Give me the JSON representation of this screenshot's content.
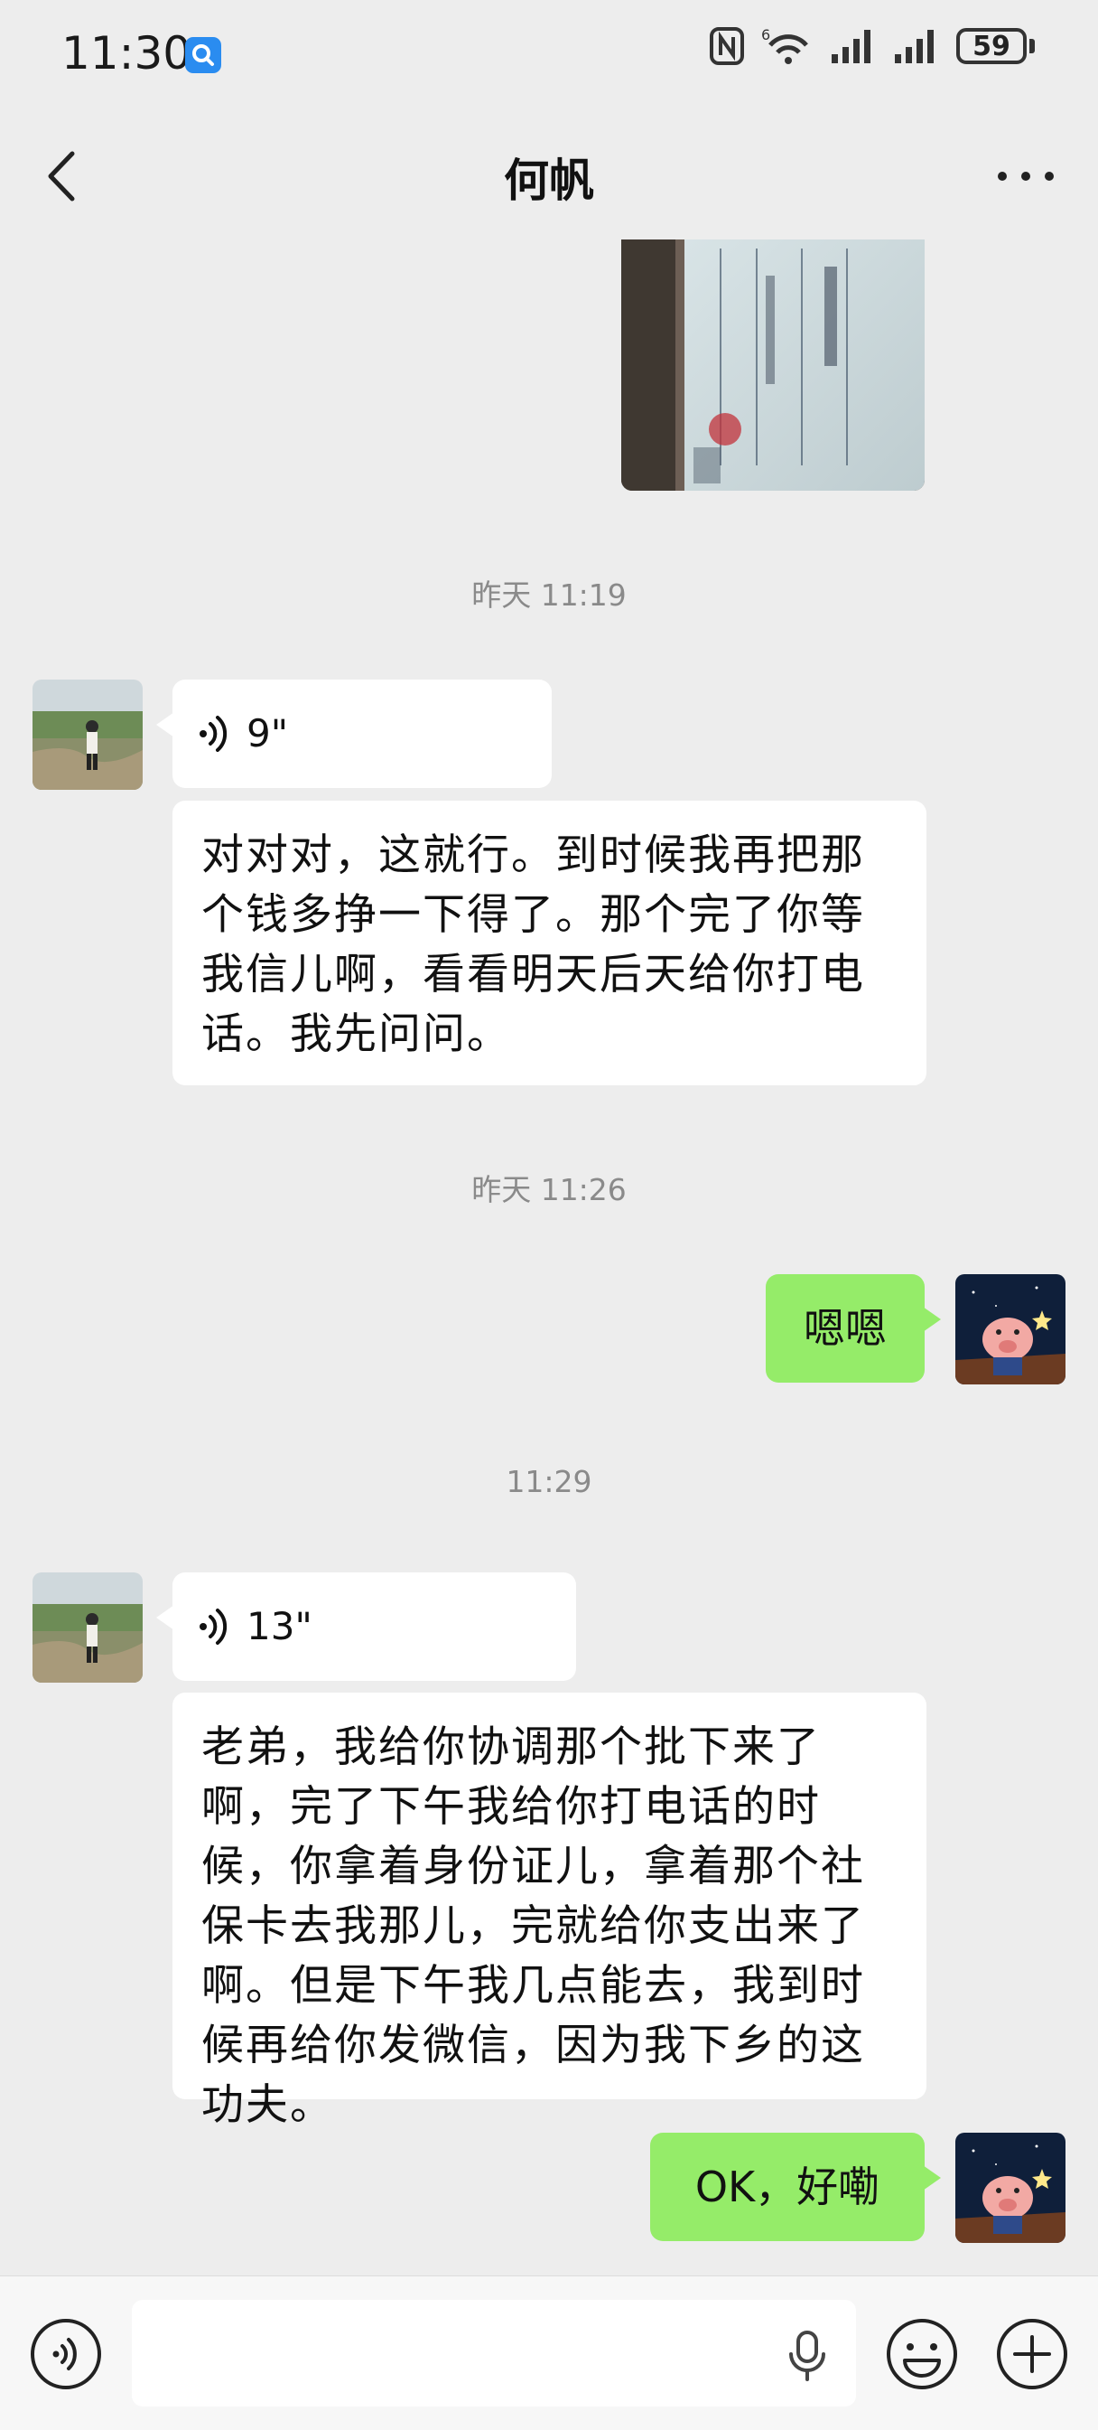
{
  "status_bar": {
    "time": "11:30",
    "battery": "59"
  },
  "header": {
    "title": "何帆"
  },
  "messages": {
    "ts1": "昨天 11:19",
    "voice1": "9\"",
    "text1": "对对对，这就行。到时候我再把那个钱多挣一下得了。那个完了你等我信儿啊，看看明天后天给你打电话。我先问问。",
    "ts2": "昨天 11:26",
    "out1": "嗯嗯",
    "ts3": "11:29",
    "voice2": "13\"",
    "text2": "老弟，我给你协调那个批下来了啊，完了下午我给你打电话的时候，你拿着身份证儿，拿着那个社保卡去我那儿，完就给你支出来了啊。但是下午我几点能去，我到时候再给你发微信，因为我下乡的这功夫。",
    "out2": "OK，好嘞"
  },
  "receipt_image": {
    "icon": "receipt-photo"
  },
  "colors": {
    "bg": "#ededed",
    "out_bubble": "#95ec69",
    "in_bubble": "#ffffff",
    "badge": "#2a8cf0"
  },
  "input": {
    "value": ""
  }
}
